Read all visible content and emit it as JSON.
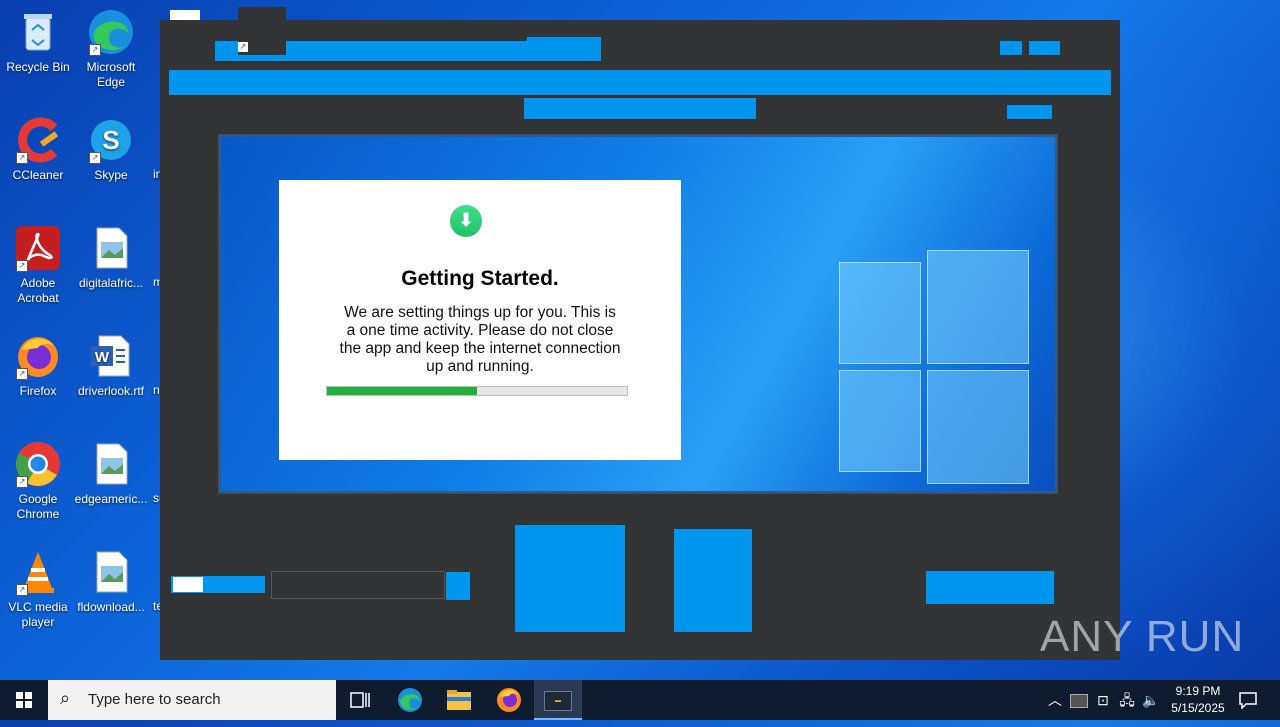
{
  "desktop": {
    "icons": [
      {
        "label": "Recycle Bin"
      },
      {
        "label": "Microsoft Edge"
      },
      {
        "label": "CCleaner"
      },
      {
        "label": "Skype"
      },
      {
        "label": "Adobe Acrobat"
      },
      {
        "label": "digitalafric..."
      },
      {
        "label": "Firefox"
      },
      {
        "label": "driverlook.rtf"
      },
      {
        "label": "Google Chrome"
      },
      {
        "label": "edgeameric..."
      },
      {
        "label": "VLC media player"
      },
      {
        "label": "fldownload..."
      }
    ],
    "cut_labels": [
      "in",
      "m",
      "n",
      "su",
      "te"
    ]
  },
  "dialog": {
    "title": "Getting Started.",
    "message": "We are setting things up for you. This is a one time activity. Please do not close the app and keep the internet connection up and running.",
    "progress_fraction": 0.5
  },
  "watermark": "ANY RUN",
  "taskbar": {
    "search_placeholder": "Type here to search",
    "time": "9:19 PM",
    "date": "5/15/2025"
  },
  "colors": {
    "accent": "#0095ef",
    "window_bg": "#333436",
    "progress": "#1fb13a",
    "taskbar": "#0f1b2e"
  }
}
